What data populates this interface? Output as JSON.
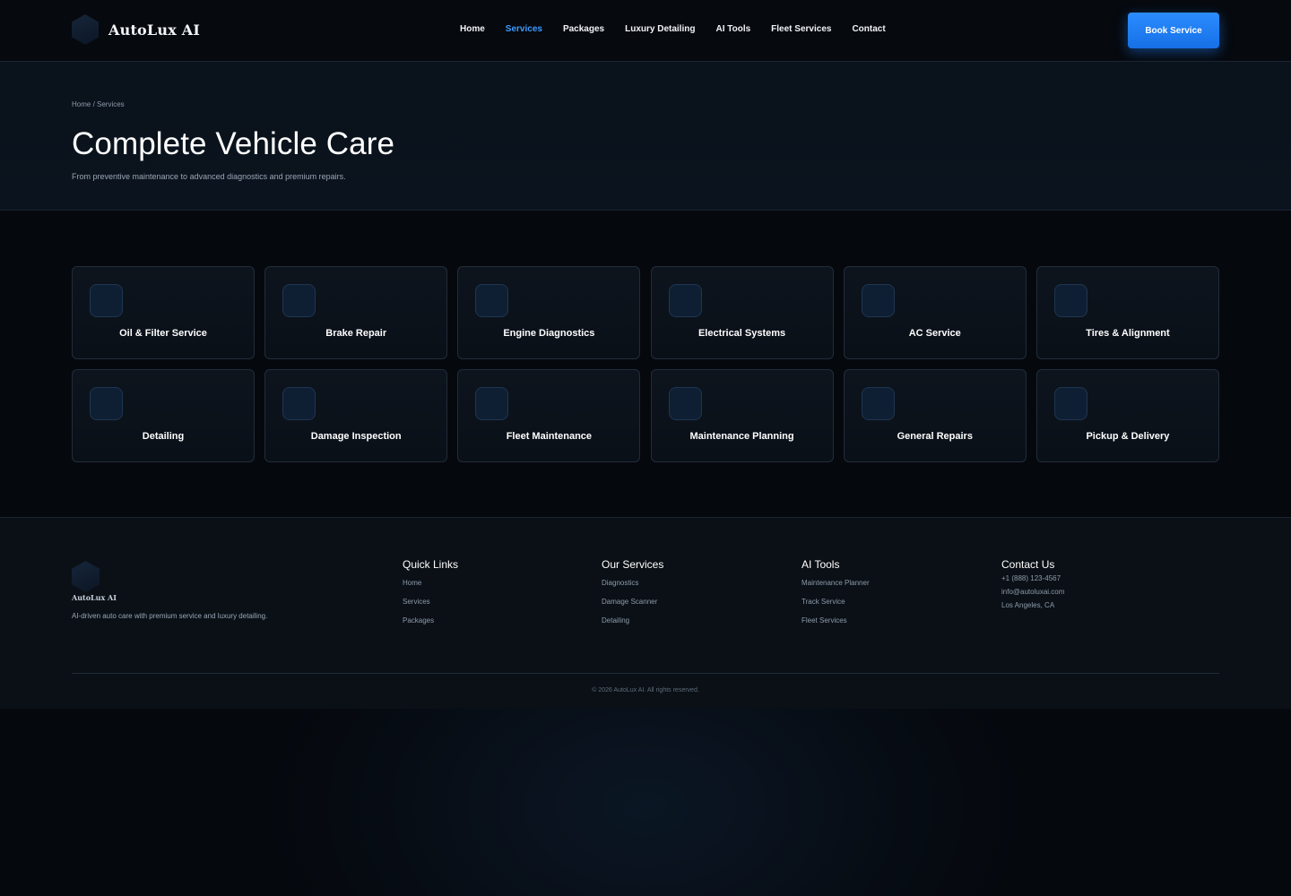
{
  "brand": {
    "name": "AutoLux AI",
    "logo_icon": "hexagon-logo-icon"
  },
  "nav": {
    "items": [
      {
        "label": "Home"
      },
      {
        "label": "Services",
        "active": true
      },
      {
        "label": "Packages"
      },
      {
        "label": "Luxury Detailing"
      },
      {
        "label": "AI Tools"
      },
      {
        "label": "Fleet Services"
      },
      {
        "label": "Contact"
      }
    ],
    "cta": "Book Service"
  },
  "hero": {
    "breadcrumb": "Home / Services",
    "title": "Complete Vehicle Care",
    "subtitle": "From preventive maintenance to advanced diagnostics and premium repairs."
  },
  "services": [
    {
      "label": "Oil & Filter Service"
    },
    {
      "label": "Brake Repair"
    },
    {
      "label": "Engine Diagnostics"
    },
    {
      "label": "Electrical Systems"
    },
    {
      "label": "AC Service"
    },
    {
      "label": "Tires & Alignment"
    },
    {
      "label": "Detailing"
    },
    {
      "label": "Damage Inspection"
    },
    {
      "label": "Fleet Maintenance"
    },
    {
      "label": "Maintenance Planning"
    },
    {
      "label": "General Repairs"
    },
    {
      "label": "Pickup & Delivery"
    }
  ],
  "footer": {
    "brand": "AutoLux AI",
    "tagline": "AI-driven auto care with premium service and luxury detailing.",
    "quick_links": {
      "title": "Quick Links",
      "links": [
        "Home",
        "Services",
        "Packages"
      ]
    },
    "our_services": {
      "title": "Our Services",
      "links": [
        "Diagnostics",
        "Damage Scanner",
        "Detailing"
      ]
    },
    "ai_tools": {
      "title": "AI Tools",
      "links": [
        "Maintenance Planner",
        "Track Service",
        "Fleet Services"
      ]
    },
    "contact": {
      "title": "Contact Us",
      "phone": "+1 (888) 123-4567",
      "email": "info@autoluxai.com",
      "location": "Los Angeles, CA"
    },
    "copyright": "© 2026 AutoLux AI. All rights reserved."
  },
  "colors": {
    "accent": "#2b8cff",
    "active_nav": "#3c9bff",
    "background": "#05080d",
    "card": "#0d141d"
  }
}
